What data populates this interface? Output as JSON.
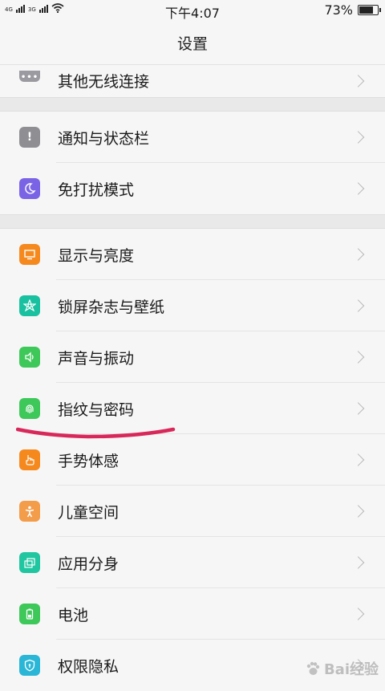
{
  "status": {
    "network_a": "4G",
    "network_b": "3G",
    "time": "下午4:07",
    "battery_text": "73%",
    "battery_level": 0.73
  },
  "header": {
    "title": "设置"
  },
  "rows": [
    {
      "label": "其他无线连接",
      "icon": "more-icon",
      "color": "#9a9aa0"
    },
    {
      "label": "通知与状态栏",
      "icon": "notification-icon",
      "color": "#8e8e93"
    },
    {
      "label": "免打扰模式",
      "icon": "moon-icon",
      "color": "#7b63e6"
    },
    {
      "label": "显示与亮度",
      "icon": "display-icon",
      "color": "#f5891e"
    },
    {
      "label": "锁屏杂志与壁纸",
      "icon": "flower-icon",
      "color": "#19c1a0"
    },
    {
      "label": "声音与振动",
      "icon": "speaker-icon",
      "color": "#3ec85a"
    },
    {
      "label": "指纹与密码",
      "icon": "fingerprint-icon",
      "color": "#3ec85a"
    },
    {
      "label": "手势体感",
      "icon": "hand-icon",
      "color": "#f5891e"
    },
    {
      "label": "儿童空间",
      "icon": "child-icon",
      "color": "#f39c4a"
    },
    {
      "label": "应用分身",
      "icon": "clone-icon",
      "color": "#1fc6a0"
    },
    {
      "label": "电池",
      "icon": "battery-icon",
      "color": "#3ec85a"
    },
    {
      "label": "权限隐私",
      "icon": "shield-icon",
      "color": "#2ab6d6"
    }
  ],
  "watermark": {
    "text": "Bai经验"
  },
  "annotation": {
    "color": "#d8285a"
  }
}
